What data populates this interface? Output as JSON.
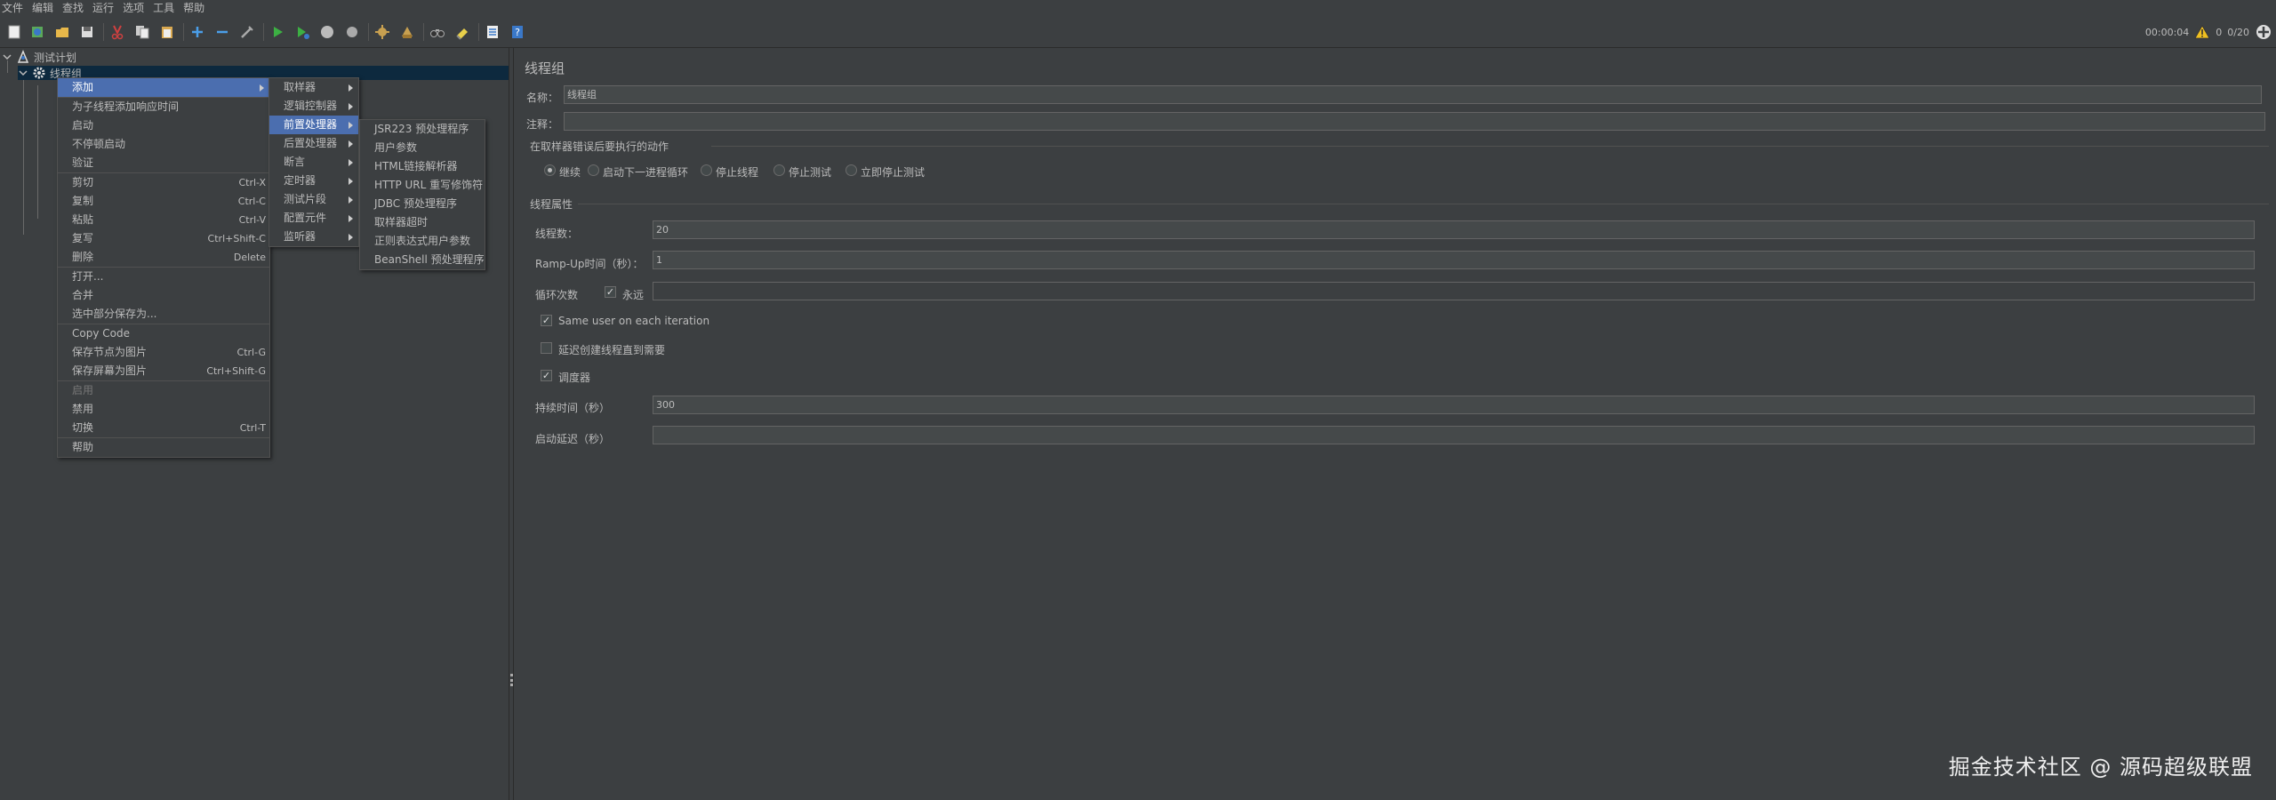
{
  "menubar": {
    "items": [
      "文件",
      "编辑",
      "查找",
      "运行",
      "选项",
      "工具",
      "帮助"
    ]
  },
  "toolbar": {
    "icons": [
      "new-icon",
      "templates-icon",
      "open-icon",
      "save-icon",
      "cut-icon",
      "copy-icon",
      "paste-icon",
      "expand-icon",
      "collapse-icon",
      "toggle-icon",
      "start-icon",
      "start-no-pause-icon",
      "stop-icon",
      "shutdown-icon",
      "clear-icon",
      "clear-all-icon",
      "search-icon",
      "reset-search-icon",
      "function-helper-icon",
      "help-icon"
    ],
    "elapsed": "00:00:04",
    "warnings": "0",
    "threads": "0/20"
  },
  "tree": {
    "root": "测试计划",
    "child": "线程组"
  },
  "context_menu": {
    "items": [
      {
        "label": "添加",
        "shortcut": "",
        "submenu": true,
        "active": true
      },
      {
        "sep": true
      },
      {
        "label": "为子线程添加响应时间",
        "shortcut": ""
      },
      {
        "label": "启动",
        "shortcut": ""
      },
      {
        "label": "不停顿启动",
        "shortcut": ""
      },
      {
        "label": "验证",
        "shortcut": ""
      },
      {
        "sep": true
      },
      {
        "label": "剪切",
        "shortcut": "Ctrl-X"
      },
      {
        "label": "复制",
        "shortcut": "Ctrl-C"
      },
      {
        "label": "粘贴",
        "shortcut": "Ctrl-V"
      },
      {
        "label": "复写",
        "shortcut": "Ctrl+Shift-C"
      },
      {
        "label": "删除",
        "shortcut": "Delete"
      },
      {
        "sep": true
      },
      {
        "label": "打开...",
        "shortcut": ""
      },
      {
        "label": "合并",
        "shortcut": ""
      },
      {
        "label": "选中部分保存为...",
        "shortcut": ""
      },
      {
        "sep": true
      },
      {
        "label": "Copy Code",
        "shortcut": ""
      },
      {
        "label": "保存节点为图片",
        "shortcut": "Ctrl-G"
      },
      {
        "label": "保存屏幕为图片",
        "shortcut": "Ctrl+Shift-G"
      },
      {
        "sep": true
      },
      {
        "label": "启用",
        "shortcut": "",
        "disabled": true
      },
      {
        "label": "禁用",
        "shortcut": ""
      },
      {
        "label": "切换",
        "shortcut": "Ctrl-T"
      },
      {
        "sep": true
      },
      {
        "label": "帮助",
        "shortcut": ""
      }
    ]
  },
  "add_menu": {
    "items": [
      {
        "label": "取样器",
        "submenu": true
      },
      {
        "label": "逻辑控制器",
        "submenu": true
      },
      {
        "label": "前置处理器",
        "submenu": true,
        "active": true
      },
      {
        "label": "后置处理器",
        "submenu": true
      },
      {
        "label": "断言",
        "submenu": true
      },
      {
        "label": "定时器",
        "submenu": true
      },
      {
        "label": "测试片段",
        "submenu": true
      },
      {
        "label": "配置元件",
        "submenu": true
      },
      {
        "label": "监听器",
        "submenu": true
      }
    ]
  },
  "preprocessor_menu": {
    "items": [
      "JSR223 预处理程序",
      "用户参数",
      "HTML链接解析器",
      "HTTP URL 重写修饰符",
      "JDBC 预处理程序",
      "取样器超时",
      "正则表达式用户参数",
      "BeanShell 预处理程序"
    ]
  },
  "form": {
    "title": "线程组",
    "name_label": "名称：",
    "name_value": "线程组",
    "comment_label": "注释：",
    "comment_value": "",
    "error_group_title": "在取样器错误后要执行的动作",
    "error_actions": [
      "继续",
      "启动下一进程循环",
      "停止线程",
      "停止测试",
      "立即停止测试"
    ],
    "error_selected": 0,
    "props_title": "线程属性",
    "threads_label": "线程数：",
    "threads_value": "20",
    "rampup_label": "Ramp-Up时间（秒）：",
    "rampup_value": "1",
    "loop_label": "循环次数",
    "forever_label": "永远",
    "forever_checked": true,
    "loop_value": "",
    "same_user_label": "Same user on each iteration",
    "same_user_checked": true,
    "delay_label": "延迟创建线程直到需要",
    "delay_checked": false,
    "scheduler_label": "调度器",
    "scheduler_checked": true,
    "duration_label": "持续时间（秒）",
    "duration_value": "300",
    "startup_delay_label": "启动延迟（秒）",
    "startup_delay_value": ""
  },
  "watermark": "掘金技术社区 @ 源码超级联盟"
}
